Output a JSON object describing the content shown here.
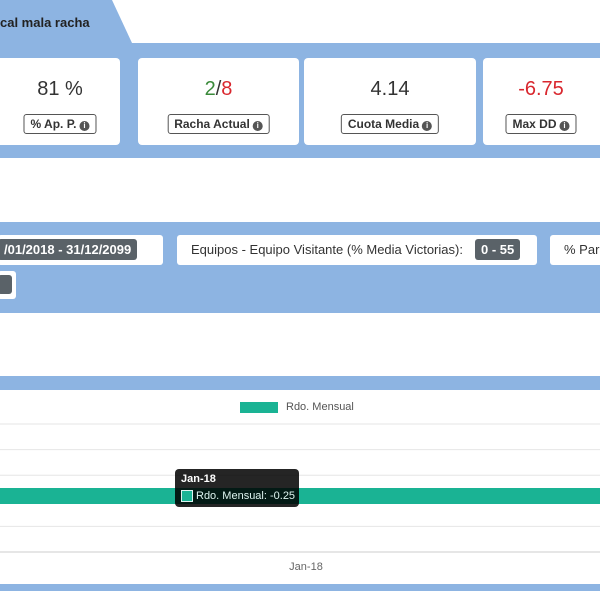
{
  "tab": {
    "title": "cal mala racha"
  },
  "stats": [
    {
      "value": "81 %",
      "label": "% Ap. P."
    },
    {
      "value_good": "2",
      "separator": "/",
      "value_bad": "8",
      "label": "Racha Actual"
    },
    {
      "value": "4.14",
      "label": "Cuota Media"
    },
    {
      "value": "-6.75",
      "label": "Max DD"
    }
  ],
  "filters": {
    "date_range": "/01/2018 - 31/12/2099",
    "away_team_label": "Equipos - Equipo Visitante (% Media Victorias):",
    "away_team_range": "0 - 55",
    "partial_label": "% Par"
  },
  "colors": {
    "band": "#8db4e2",
    "series": "#1ab394",
    "positive": "#3a8a3a",
    "negative": "#d9272e"
  },
  "chart_data": {
    "type": "bar",
    "categories": [
      "Jan-18"
    ],
    "series": [
      {
        "name": "Rdo. Mensual",
        "values": [
          -0.25
        ]
      }
    ],
    "ylim": [
      -1,
      1
    ],
    "grid": true,
    "legend": "top-center",
    "tooltip": {
      "title": "Jan-18",
      "label": "Rdo. Mensual: -0.25"
    }
  }
}
